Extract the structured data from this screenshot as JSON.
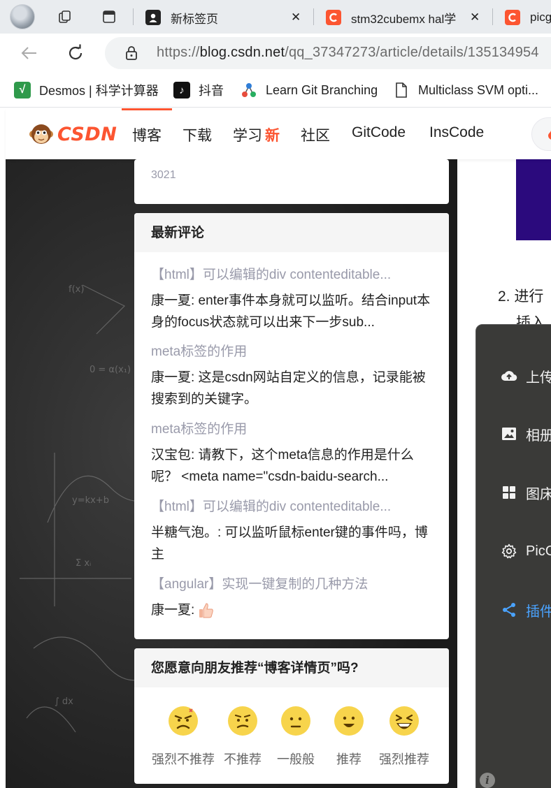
{
  "browser": {
    "tabs": [
      {
        "title": "新标签页"
      },
      {
        "title": "stm32cubemx hal学"
      },
      {
        "title": "picg"
      }
    ],
    "close_glyph": "✕",
    "url": {
      "scheme": "https://",
      "host": "blog.csdn.net",
      "path": "/qq_37347273/article/details/135134954"
    },
    "bookmarks": [
      {
        "label": "Desmos | 科学计算器",
        "icon": "desmos-icon"
      },
      {
        "label": "抖音",
        "icon": "douyin-icon"
      },
      {
        "label": "Learn Git Branching",
        "icon": "git-branch-icon"
      },
      {
        "label": "Multiclass SVM opti...",
        "icon": "document-icon"
      }
    ]
  },
  "csdn": {
    "logo_text": "CSDN",
    "nav": [
      {
        "label": "博客"
      },
      {
        "label": "下载"
      },
      {
        "label": "学习",
        "badge": "新"
      },
      {
        "label": "社区"
      },
      {
        "label": "GitCode"
      },
      {
        "label": "InsCode"
      }
    ]
  },
  "sidebar": {
    "top_stat": "3021",
    "comments_title": "最新评论",
    "comments": [
      {
        "title": "【html】可以编辑的div contenteditable...",
        "text": "康一夏: enter事件本身就可以监听。结合input本身的focus状态就可以出来下一步sub..."
      },
      {
        "title": "meta标签的作用",
        "text": "康一夏: 这是csdn网站自定义的信息，记录能被搜索到的关键字。"
      },
      {
        "title": "meta标签的作用",
        "text": "汉宝包: 请教下，这个meta信息的作用是什么呢？ <meta name=\"csdn-baidu-search..."
      },
      {
        "title": "【html】可以编辑的div contenteditable...",
        "text": "半糖气泡。: 可以监听鼠标enter键的事件吗，博主"
      },
      {
        "title": "【angular】实现一键复制的几种方法",
        "text": "康一夏: "
      }
    ],
    "recommend_title": "您愿意向朋友推荐“博客详情页”吗?",
    "recommend_options": [
      {
        "label": "强烈不推荐",
        "face": "angry-face-icon"
      },
      {
        "label": "不推荐",
        "face": "frown-face-icon"
      },
      {
        "label": "一般般",
        "face": "neutral-face-icon"
      },
      {
        "label": "推荐",
        "face": "smile-face-icon"
      },
      {
        "label": "强烈推荐",
        "face": "grin-face-icon"
      }
    ]
  },
  "article": {
    "step_number": "2.",
    "step_text": "进行",
    "step_text2": "插入"
  },
  "extension_panel": {
    "items": [
      {
        "label": "上传",
        "icon": "cloud-upload-icon"
      },
      {
        "label": "相册",
        "icon": "image-icon"
      },
      {
        "label": "图床",
        "icon": "grid-icon"
      },
      {
        "label": "PicG",
        "icon": "gear-icon"
      },
      {
        "label": "插件",
        "icon": "share-icon"
      }
    ],
    "info_glyph": "i"
  },
  "colors": {
    "csdn_red": "#fc5531",
    "panel_bg": "#3a3a38",
    "link_blue": "#4aa3ff"
  }
}
